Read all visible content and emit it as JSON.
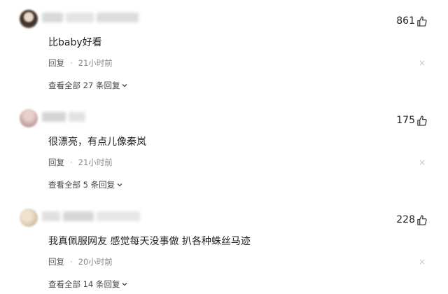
{
  "comments": [
    {
      "likes": "861",
      "text": "比baby好看",
      "reply_label": "回复",
      "separator": "·",
      "time": "21小时前",
      "close_symbol": "×",
      "view_all": "查看全部 27 条回复",
      "avatar_color": "#5a4a42"
    },
    {
      "likes": "175",
      "text": "很漂亮，有点儿像秦岚",
      "reply_label": "回复",
      "separator": "·",
      "time": "21小时前",
      "close_symbol": "×",
      "view_all": "查看全部 5 条回复",
      "avatar_color": "#c9a7a4"
    },
    {
      "likes": "228",
      "text": "我真佩服网友 感觉每天没事做 扒各种蛛丝马迹",
      "reply_label": "回复",
      "separator": "·",
      "time": "20小时前",
      "close_symbol": "×",
      "view_all": "查看全部 14 条回复",
      "avatar_color": "#d9c8b0"
    }
  ],
  "icons": {
    "like": "thumbs-up-icon",
    "expand": "chevron-down-icon",
    "close": "close-icon"
  }
}
